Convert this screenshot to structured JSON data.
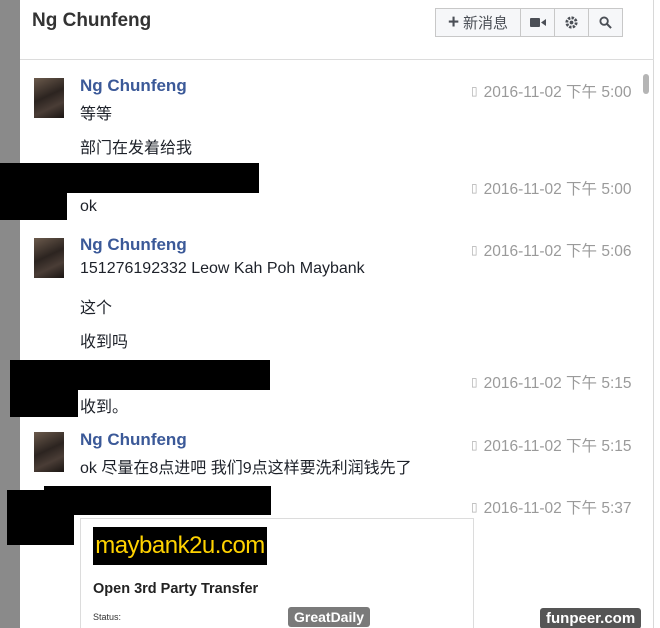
{
  "header": {
    "title": "Ng Chunfeng",
    "new_message_label": "新消息",
    "icons": [
      "plus-icon",
      "video-camera-icon",
      "gear-icon",
      "search-icon"
    ]
  },
  "messages": [
    {
      "sender": "Ng Chunfeng",
      "time": "2016-11-02 下午 5:00",
      "lines": [
        "等等",
        "部门在发着给我"
      ]
    },
    {
      "sender": "",
      "time": "2016-11-02 下午 5:00",
      "lines": [
        "ok"
      ]
    },
    {
      "sender": "Ng Chunfeng",
      "time": "2016-11-02 下午 5:06",
      "lines": [
        "151276192332 Leow Kah  Poh Maybank",
        "这个",
        "收到吗"
      ]
    },
    {
      "sender": "",
      "time": "2016-11-02 下午 5:15",
      "lines": [
        "收到。"
      ]
    },
    {
      "sender": "Ng Chunfeng",
      "time": "2016-11-02 下午 5:15",
      "lines": [
        "ok 尽量在8点进吧 我们9点这样要洗利润钱先了"
      ]
    },
    {
      "sender": "",
      "time": "2016-11-02 下午 5:37",
      "lines": []
    }
  ],
  "attachment": {
    "logo_text": "maybank2u.com",
    "title": "Open 3rd Party Transfer",
    "status_label": "Status:"
  },
  "watermarks": {
    "left": "GreatDaily",
    "right": "funpeer.com"
  },
  "colors": {
    "sender_name": "#3b5998",
    "timestamp": "#9a9a9a",
    "logo_text": "#ffd200"
  }
}
